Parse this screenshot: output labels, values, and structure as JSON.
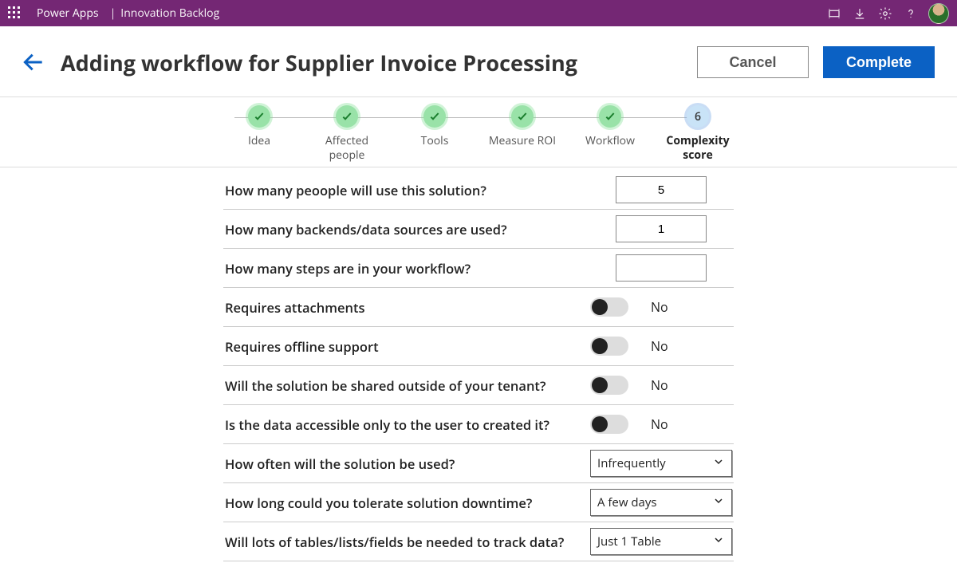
{
  "topbar": {
    "brand": "Power Apps",
    "separator": "|",
    "app_name": "Innovation Backlog"
  },
  "header": {
    "title": "Adding workflow for Supplier Invoice Processing",
    "cancel_label": "Cancel",
    "complete_label": "Complete"
  },
  "stepper": {
    "steps": [
      {
        "label": "Idea",
        "done": true
      },
      {
        "label": "Affected people",
        "done": true
      },
      {
        "label": "Tools",
        "done": true
      },
      {
        "label": "Measure ROI",
        "done": true
      },
      {
        "label": "Workflow",
        "done": true
      },
      {
        "label": "Complexity score",
        "done": false,
        "current": true,
        "number": "6"
      }
    ]
  },
  "form": {
    "q_people": "How many peoople will use this solution?",
    "v_people": "5",
    "q_backends": "How many backends/data sources are  used?",
    "v_backends": "1",
    "q_steps": "How many steps are in your workflow?",
    "v_steps": "",
    "q_attachments": "Requires attachments",
    "v_attachments": "No",
    "q_offline": "Requires offline support",
    "v_offline": "No",
    "q_shared": "Will the solution be shared  outside of your tenant?",
    "v_shared": "No",
    "q_dataaccess": "Is the data accessible only to the user to created it?",
    "v_dataaccess": "No",
    "q_frequency": "How often will the solution be used?",
    "v_frequency": "Infrequently",
    "q_downtime": "How long could you tolerate solution downtime?",
    "v_downtime": "A few days",
    "q_tables": "Will lots of tables/lists/fields be needed to track data?",
    "v_tables": "Just 1 Table"
  }
}
